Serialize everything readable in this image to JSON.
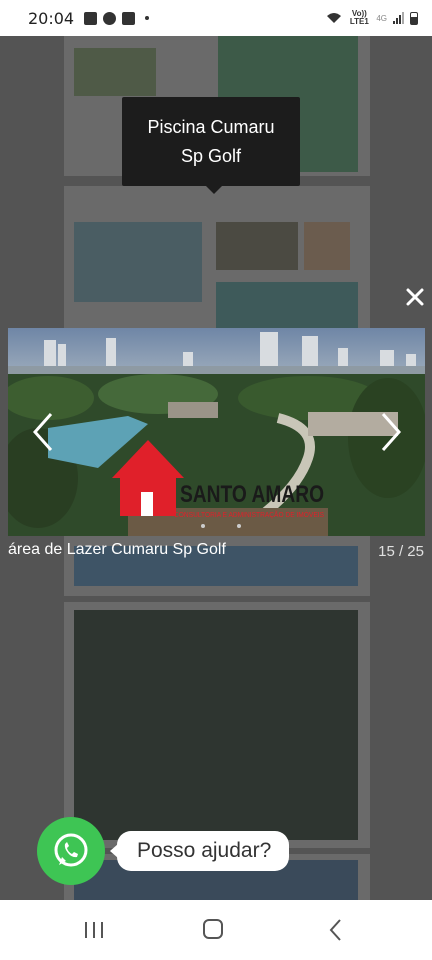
{
  "status_bar": {
    "time": "20:04",
    "network_label": "Vo)) LTE1",
    "network_type": "4G",
    "icons": [
      "gallery-icon",
      "chrome-icon",
      "mail-icon",
      "wifi-icon",
      "signal-icon",
      "battery-icon"
    ]
  },
  "tooltip": {
    "line1": "Piscina Cumaru",
    "line2": "Sp Golf"
  },
  "lightbox": {
    "caption": "área de Lazer Cumaru Sp Golf",
    "counter": "15 / 25",
    "watermark_title": "SANTO AMARO",
    "watermark_subtitle": "CONSULTORIA E ADMINISTRAÇÃO DE IMÓVEIS"
  },
  "whatsapp": {
    "label": "Posso ajudar?",
    "color": "#3ec554"
  },
  "colors": {
    "overlay": "#4a4a4a",
    "brand_red": "#e0202a"
  }
}
